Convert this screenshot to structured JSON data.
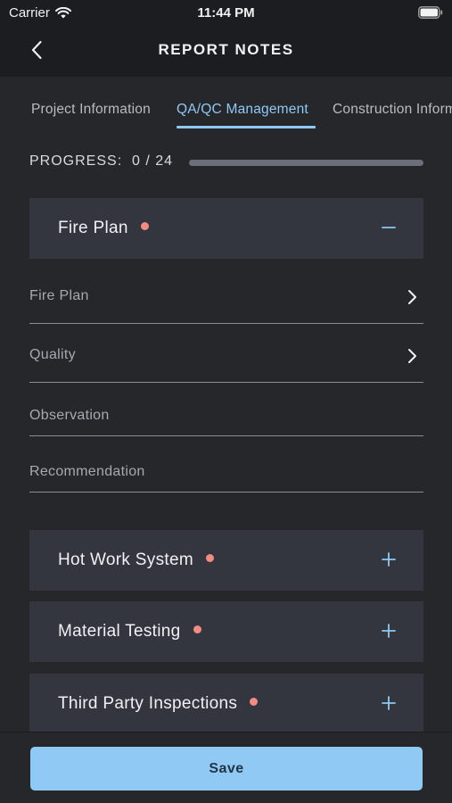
{
  "status_bar": {
    "carrier": "Carrier",
    "time": "11:44 PM"
  },
  "nav": {
    "title": "REPORT NOTES"
  },
  "tabs": [
    {
      "label": "Project Information",
      "active": false
    },
    {
      "label": "QA/QC Management",
      "active": true
    },
    {
      "label": "Construction Information",
      "active": false
    }
  ],
  "progress": {
    "label": "PROGRESS:",
    "text": "0 / 24",
    "completed": 0,
    "total": 24
  },
  "sections": [
    {
      "title": "Fire Plan",
      "expanded": true,
      "fields": [
        {
          "label": "Fire Plan",
          "type": "select"
        },
        {
          "label": "Quality",
          "type": "select"
        },
        {
          "label": "Observation",
          "type": "text"
        },
        {
          "label": "Recommendation",
          "type": "text"
        }
      ]
    },
    {
      "title": "Hot Work System",
      "expanded": false
    },
    {
      "title": "Material Testing",
      "expanded": false
    },
    {
      "title": "Third Party Inspections",
      "expanded": false
    }
  ],
  "footer": {
    "save_label": "Save"
  },
  "colors": {
    "accent": "#8fc9f4",
    "indicator": "#f28b82",
    "background": "#25272b",
    "card": "#33363e"
  }
}
